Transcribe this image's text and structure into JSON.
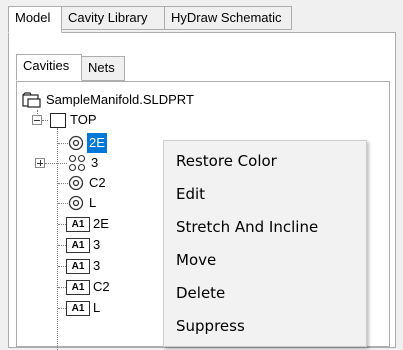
{
  "tabs": {
    "model": "Model",
    "cavity_library": "Cavity Library",
    "hydraw": "HyDraw Schematic"
  },
  "subtabs": {
    "cavities": "Cavities",
    "nets": "Nets"
  },
  "tree": {
    "root": "SampleManifold.SLDPRT",
    "top": "TOP",
    "children": [
      {
        "label": "2E",
        "icon": "cavity-circle-icon"
      },
      {
        "label": "3",
        "icon": "cavity-group-icon"
      },
      {
        "label": "C2",
        "icon": "cavity-circle-icon"
      },
      {
        "label": "L",
        "icon": "cavity-circle-icon"
      },
      {
        "label": "2E",
        "icon": "a1-icon",
        "badge": "A1"
      },
      {
        "label": "3",
        "icon": "a1-icon",
        "badge": "A1"
      },
      {
        "label": "3",
        "icon": "a1-icon",
        "badge": "A1"
      },
      {
        "label": "C2",
        "icon": "a1-icon",
        "badge": "A1"
      },
      {
        "label": "L",
        "icon": "a1-icon",
        "badge": "A1"
      }
    ]
  },
  "context_menu": {
    "items": [
      "Restore Color",
      "Edit",
      "Stretch And Incline",
      "Move",
      "Delete",
      "Suppress"
    ]
  },
  "colors": {
    "selection": "#0078d7",
    "menu_bg": "#f2f2f2"
  }
}
